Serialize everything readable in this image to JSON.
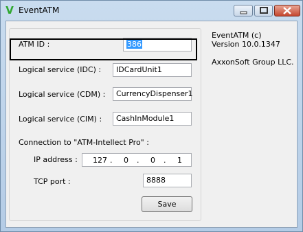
{
  "window": {
    "title": "EventATM",
    "icon": "v-logo-icon",
    "controls": [
      "minimize-icon",
      "maximize-icon",
      "close-icon"
    ]
  },
  "form": {
    "atm_id": {
      "label": "ATM ID :",
      "value": "386"
    },
    "idc": {
      "label": "Logical service (IDC) :",
      "value": "IDCardUnit1"
    },
    "cdm": {
      "label": "Logical service (CDM) :",
      "value": "CurrencyDispenser1"
    },
    "cim": {
      "label": "Logical service (CIM) :",
      "value": "CashInModule1"
    },
    "connection_label": "Connection to \"ATM-Intellect Pro\" :",
    "ip": {
      "label": "IP address :",
      "octets": [
        "127",
        "0",
        "0",
        "1"
      ]
    },
    "tcp": {
      "label": "TCP port :",
      "value": "8888"
    },
    "save_label": "Save"
  },
  "about": {
    "line1": "EventATM (c)",
    "line2": "Version 10.0.1347",
    "line3": "AxxonSoft Group LLC."
  },
  "colors": {
    "selection": "#3399ff",
    "highlight_border": "#000000",
    "logo": "#2fa82f"
  }
}
